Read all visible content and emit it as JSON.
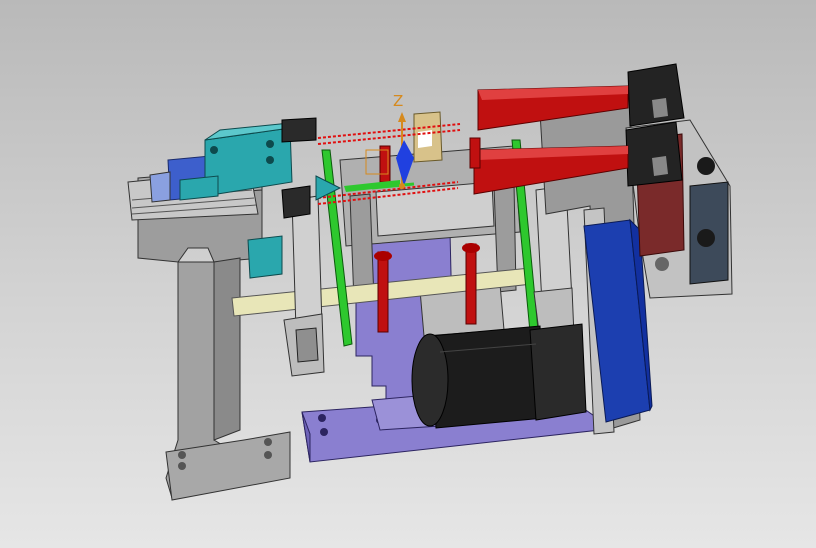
{
  "viewport": {
    "triad": {
      "axis_label": "Z"
    }
  },
  "colors": {
    "background_top": "#b9b9b9",
    "background_bottom": "#e6e6e6",
    "frame_gray": "#9a9a9a",
    "base_purple": "#8a7fd0",
    "motor_black": "#1c1c1c",
    "cylinder_blue": "#1c3fb0",
    "bracket_teal": "#2aa7ad",
    "cone_red": "#c01010",
    "guide_green": "#2ec82e",
    "rail_cream": "#e8e6b8",
    "triad_orange": "#d68a1e"
  }
}
